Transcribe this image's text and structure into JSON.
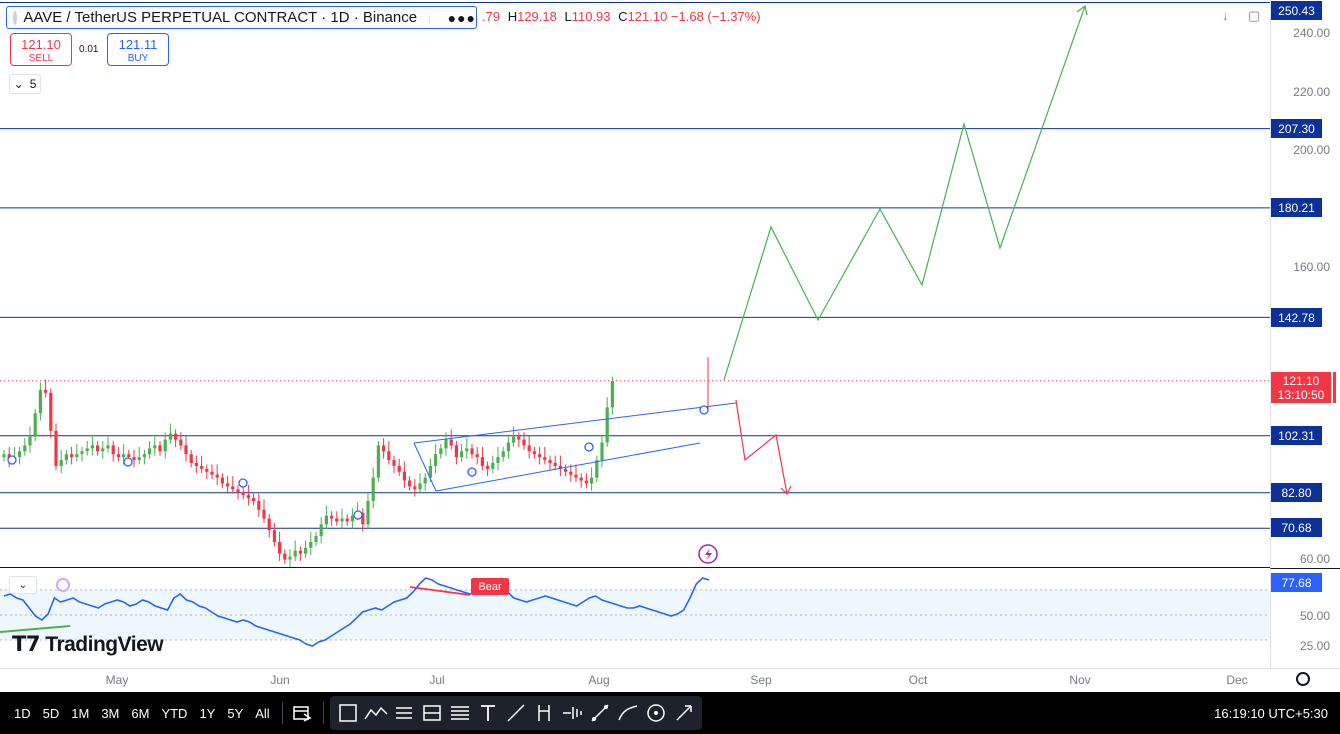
{
  "legend": {
    "title": "AAVE / TetherUS PERPETUAL CONTRACT · 1D · Binance",
    "more_icon": "ellipsis-icon",
    "ohlc_open": ".79",
    "ohlc_high_label": "H",
    "ohlc_high": "129.18",
    "ohlc_low_label": "L",
    "ohlc_low": "110.93",
    "ohlc_close_label": "C",
    "ohlc_close": "121.10",
    "change": "−1.68 (−1.37%)"
  },
  "trade": {
    "sell_price": "121.10",
    "sell_label": "SELL",
    "spread": "0.01",
    "buy_price": "121.11",
    "buy_label": "BUY"
  },
  "indicators_collapse": {
    "count": "5"
  },
  "price_scale": {
    "ticks": [
      "240.00",
      "220.00",
      "200.00",
      "160.00",
      "60.00"
    ],
    "level_labels": [
      "250.43",
      "207.30",
      "180.21",
      "142.78",
      "102.31",
      "82.80",
      "70.68"
    ],
    "current_price": "121.10",
    "countdown": "13:10:50"
  },
  "rsi": {
    "value": "77.68",
    "ticks": [
      "50.00",
      "25.00"
    ],
    "bear_label": "Bear"
  },
  "time_axis": {
    "labels": [
      "May",
      "Jun",
      "Jul",
      "Aug",
      "Sep",
      "Oct",
      "Nov",
      "Dec"
    ]
  },
  "toolbar": {
    "ranges": [
      "1D",
      "5D",
      "1M",
      "3M",
      "6M",
      "YTD",
      "1Y",
      "5Y",
      "All"
    ],
    "clock": "16:19:10 UTC+5:30"
  },
  "brand": {
    "logo_text": "TradingView"
  },
  "colors": {
    "up": "#4caf50",
    "down": "#f23645",
    "level_line": "#0c3299",
    "channel": "#2962ff",
    "projection_up": "#4caf50",
    "projection_down": "#f23645",
    "rsi_line": "#2962ff"
  }
}
